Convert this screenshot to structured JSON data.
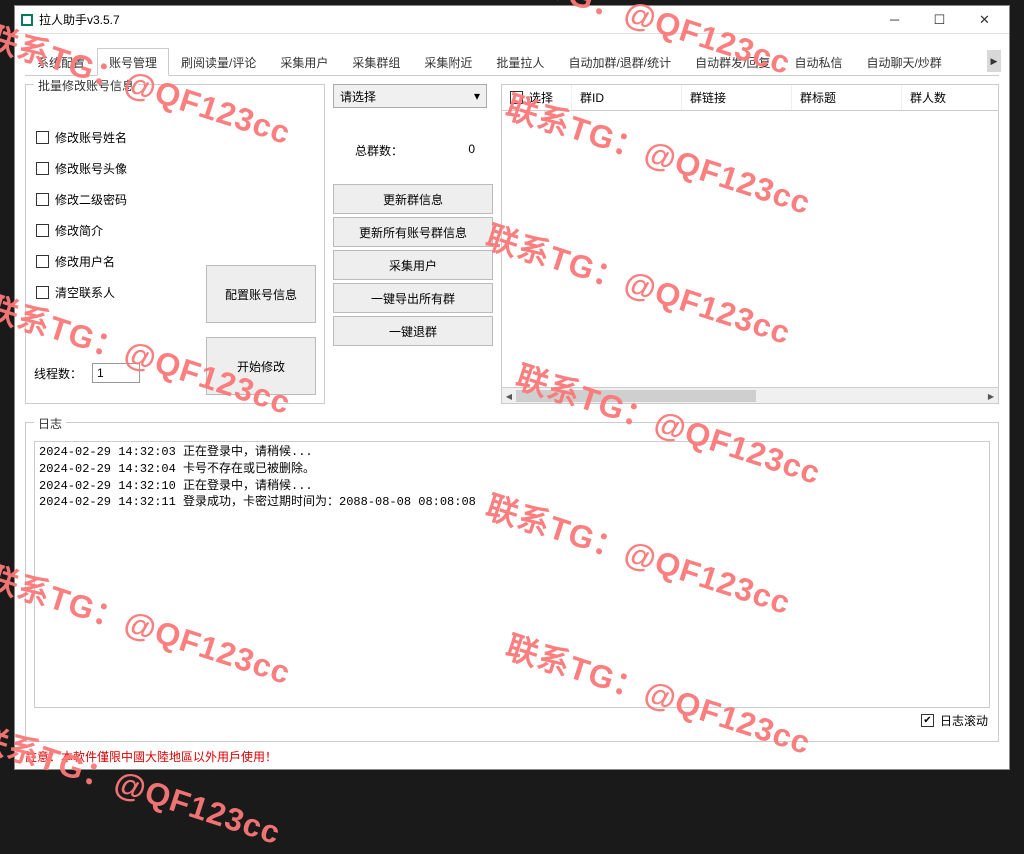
{
  "window": {
    "title": "拉人助手v3.5.7"
  },
  "tabs": {
    "items": [
      "系统配置",
      "账号管理",
      "刷阅读量/评论",
      "采集用户",
      "采集群组",
      "采集附近",
      "批量拉人",
      "自动加群/退群/统计",
      "自动群发/回复",
      "自动私信",
      "自动聊天/炒群"
    ],
    "active_index": 1
  },
  "leftPanel": {
    "legend": "批量修改账号信息",
    "checks": [
      "修改账号姓名",
      "修改账号头像",
      "修改二级密码",
      "修改简介",
      "修改用户名",
      "清空联系人"
    ],
    "thread_label": "线程数：",
    "thread_value": "1",
    "btn_config": "配置账号信息",
    "btn_start": "开始修改"
  },
  "midPanel": {
    "select_placeholder": "请选择",
    "total_label": "总群数：",
    "total_value": "0",
    "buttons": [
      "更新群信息",
      "更新所有账号群信息",
      "采集用户",
      "一键导出所有群",
      "一键退群"
    ]
  },
  "table": {
    "headers": [
      "选择",
      "群ID",
      "群链接",
      "群标题",
      "群人数"
    ]
  },
  "log": {
    "legend": "日志",
    "lines": [
      "2024-02-29 14:32:03 正在登录中，请稍候...",
      "2024-02-29 14:32:04 卡号不存在或已被删除。",
      "2024-02-29 14:32:10 正在登录中，请稍候...",
      "2024-02-29 14:32:11 登录成功，卡密过期时间为：2088-08-08 08:08:08"
    ],
    "scroll_label": "日志滚动",
    "scroll_checked": true
  },
  "footer": {
    "note": "註意：本軟件僅限中國大陸地區以外用戶使用！"
  },
  "watermark": "联系TG：@QF123cc"
}
